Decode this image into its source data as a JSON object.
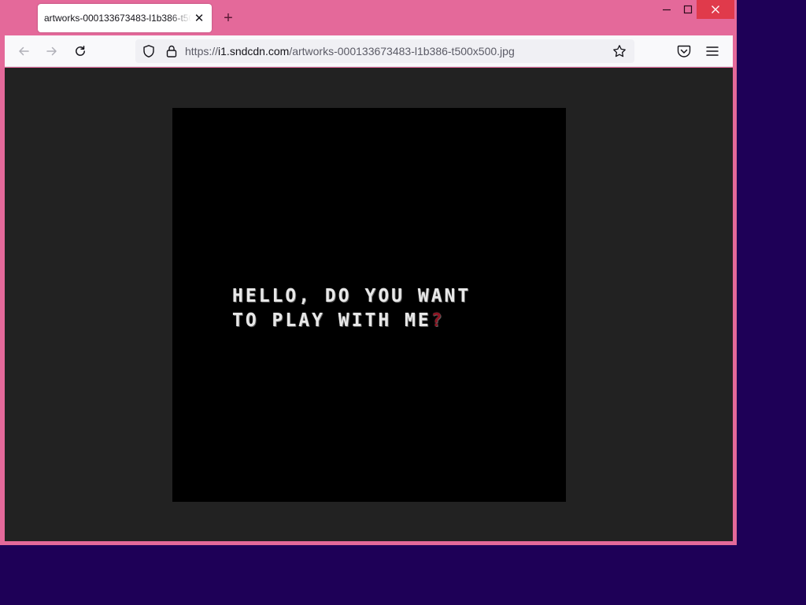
{
  "browser": {
    "tab_title": "artworks-000133673483-l1b386-t500x500.jpg",
    "tab_close": "✕",
    "new_tab": "+",
    "window_controls": {
      "minimize": "–",
      "maximize": "▢",
      "close": "✕"
    }
  },
  "urlbar": {
    "scheme": "https://",
    "host": "i1.sndcdn.com",
    "path": "/artworks-000133673483-l1b386-t500x500.jpg"
  },
  "icons": {
    "back": "arrow-left-icon",
    "forward": "arrow-right-icon",
    "reload": "reload-icon",
    "tracking": "shield-icon",
    "security": "lock-icon",
    "bookmark": "star-icon",
    "pocket": "pocket-icon",
    "menu": "hamburger-menu-icon"
  },
  "artwork": {
    "line1": "HELLO, DO YOU WANT",
    "line2_main": "TO PLAY WITH ME",
    "line2_accent": "?"
  },
  "colors": {
    "titlebar": "#e4699a",
    "desktop": "#1e0057",
    "viewer_bg": "#222222",
    "image_bg": "#000000",
    "accent_red": "#8e1220"
  }
}
